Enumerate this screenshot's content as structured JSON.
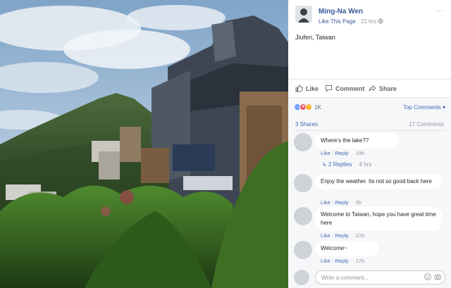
{
  "post": {
    "author": "Ming-Na Wen",
    "like_page": "Like This Page",
    "time": "22 hrs",
    "separator": "·",
    "text": "Jiufen, Taiwan",
    "menu": "···"
  },
  "actions": {
    "like": "Like",
    "comment": "Comment",
    "share": "Share"
  },
  "reactions": {
    "count": "1K",
    "icons": [
      "like-icon",
      "love-icon",
      "wow-icon"
    ],
    "colors": {
      "like": "#5890ff",
      "love": "#f25268",
      "wow": "#f7b125"
    }
  },
  "feed": {
    "top_comments": "Top Comments ▾",
    "shares": "3 Shares",
    "comments_count": "17 Comments"
  },
  "comments": [
    {
      "text": "Where's the lake??",
      "like": "Like",
      "reply": "Reply",
      "time": "19h"
    },
    {
      "text": "Enjoy the weather. Its not so good back here",
      "like": "Like",
      "reply": "Reply",
      "time": "5h"
    },
    {
      "text": "Welcome to Taiwan, hope you have great time here",
      "like": "Like",
      "reply": "Reply",
      "time": "21h"
    },
    {
      "text": "Welcome~",
      "like": "Like",
      "reply": "Reply",
      "time": "17h"
    }
  ],
  "replies": {
    "label": "2 Replies",
    "time": "4 hrs"
  },
  "composer": {
    "placeholder": "Write a comment..."
  },
  "colors": {
    "link": "#365899",
    "accent": "#4267b2",
    "muted": "#90949c",
    "panel_bg": "#f6f7f9"
  }
}
